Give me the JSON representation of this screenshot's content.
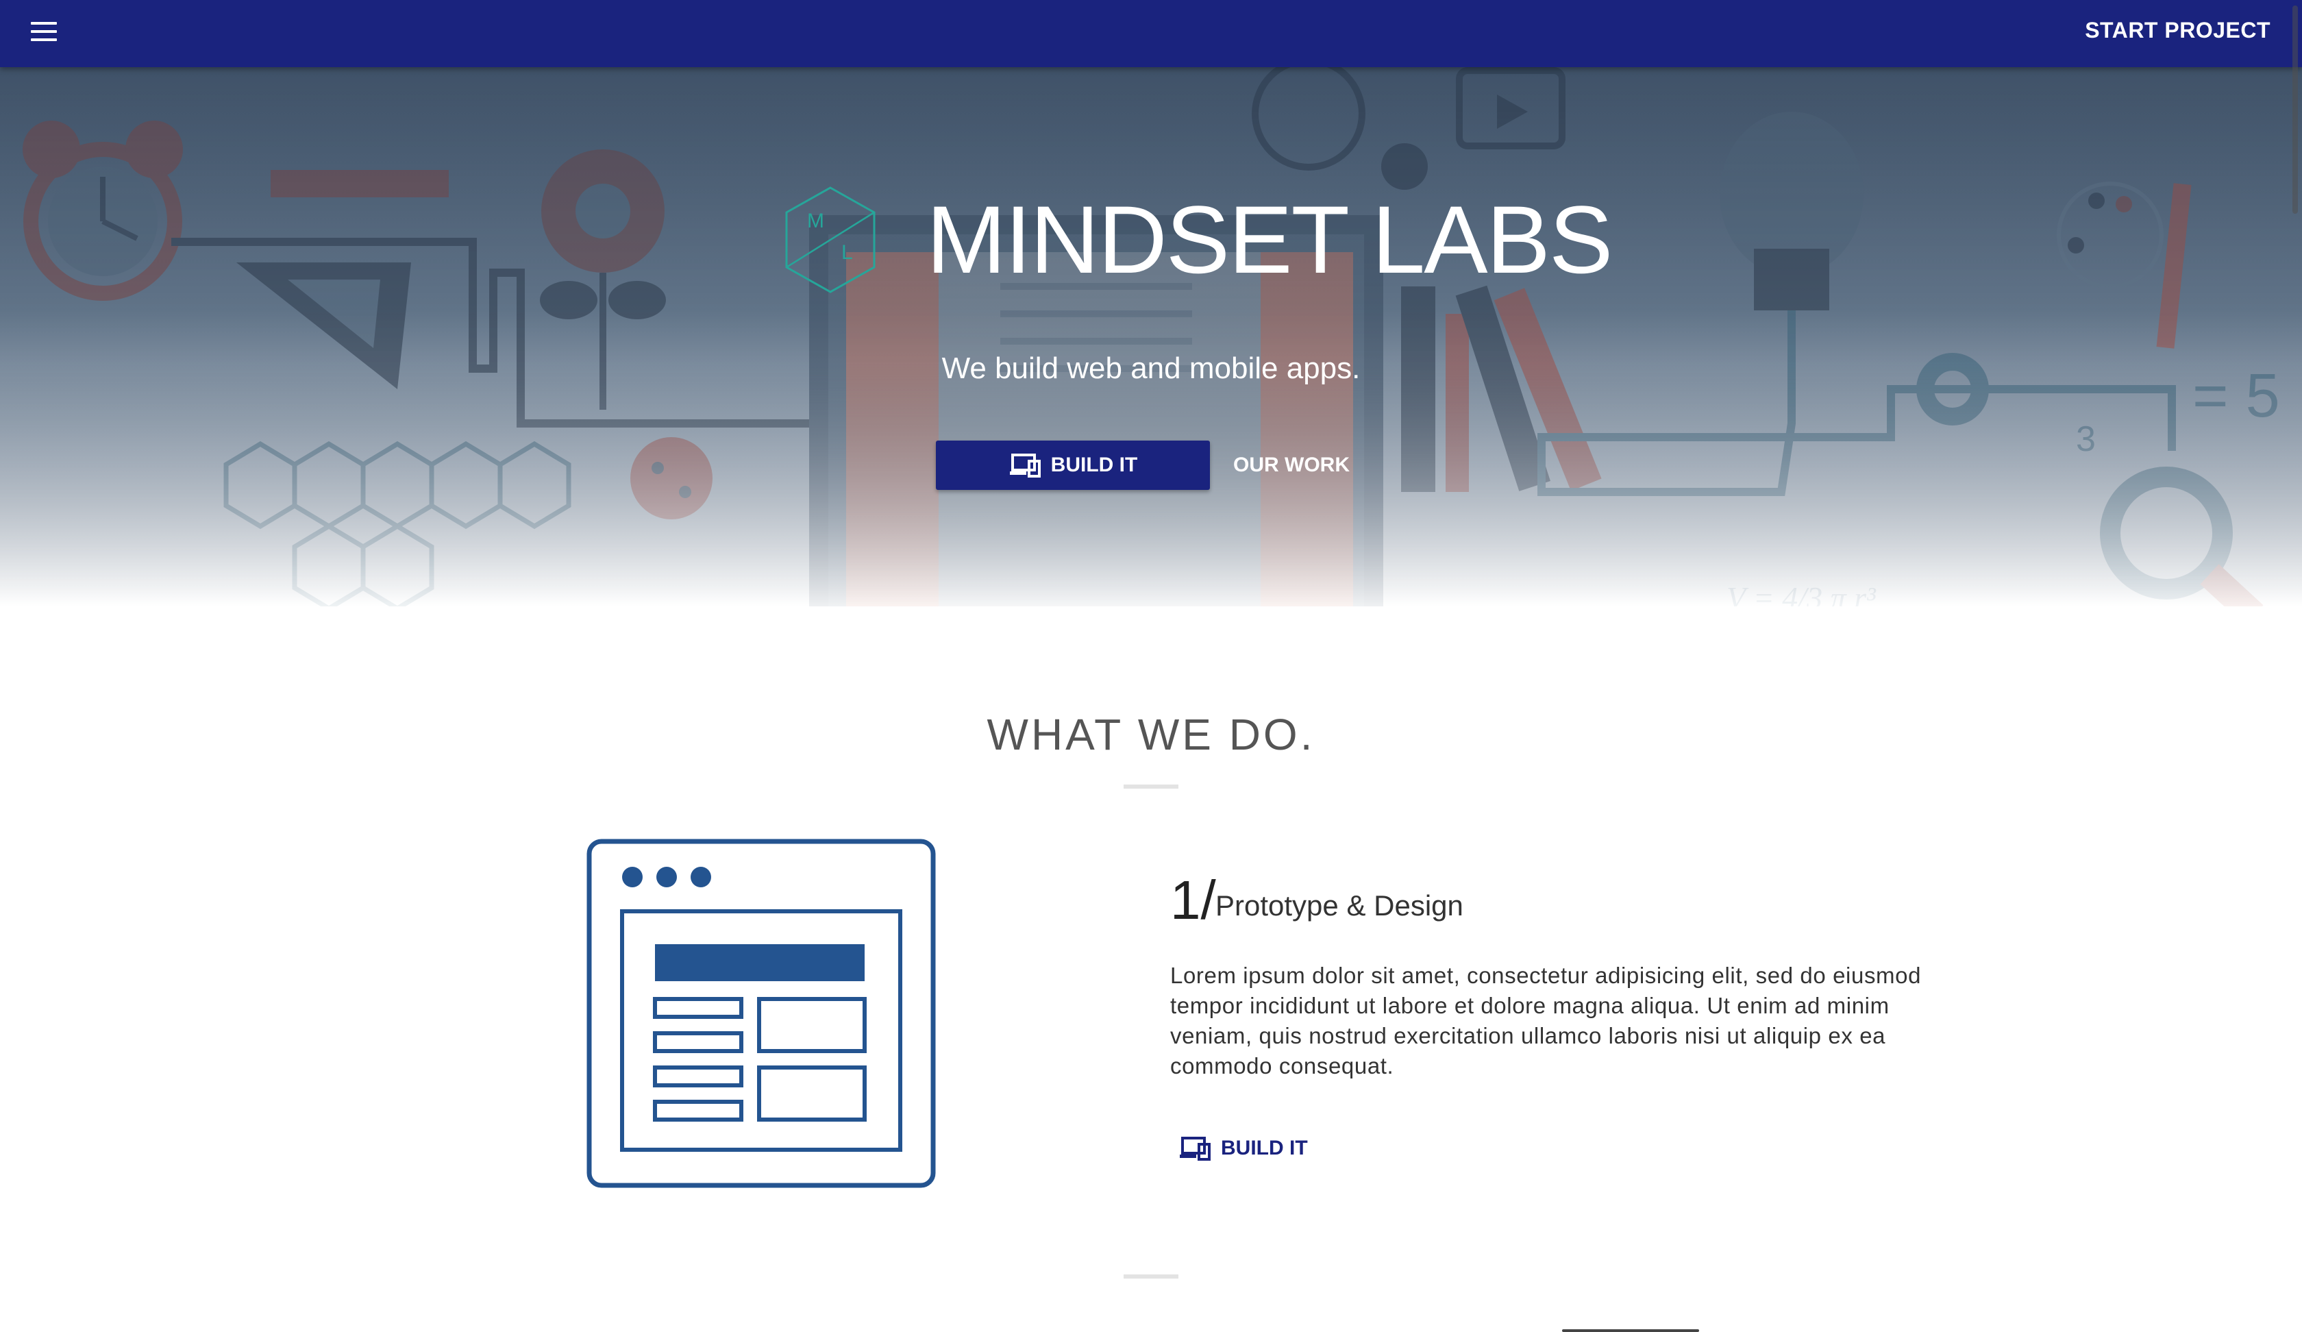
{
  "navbar": {
    "menu_icon": "hamburger-menu-icon",
    "start_project_label": "START PROJECT",
    "background_color": "#1a237e"
  },
  "hero": {
    "logo_letters": [
      "M",
      "L"
    ],
    "logo_color": "#26a69a",
    "title": "MINDSET LABS",
    "tagline": "We build web and mobile apps.",
    "build_button_label": "BUILD IT",
    "build_button_icon": "devices-icon",
    "our_work_label": "OUR WORK"
  },
  "what_we_do": {
    "heading": "WHAT WE DO.",
    "feature": {
      "number": "1/",
      "title": "Prototype & Design",
      "description": "Lorem ipsum dolor sit amet, consectetur adipisicing elit, sed do eiusmod tempor incididunt ut labore et dolore magna aliqua. Ut enim ad minim veniam, quis nostrud exercitation ullamco laboris nisi ut aliquip ex ea commodo consequat.",
      "button_label": "BUILD IT",
      "button_icon": "devices-icon",
      "illustration": "browser-wireframe-icon",
      "accent_color": "#245490"
    }
  }
}
